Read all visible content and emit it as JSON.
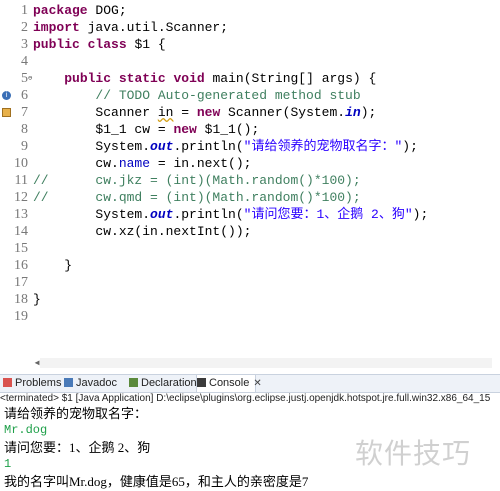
{
  "editor": {
    "lines": [
      {
        "n": "1",
        "segs": [
          {
            "t": "package",
            "c": "kw"
          },
          {
            "t": " DOG;",
            "c": ""
          }
        ]
      },
      {
        "n": "2",
        "segs": [
          {
            "t": "import",
            "c": "kw"
          },
          {
            "t": " java.util.Scanner;",
            "c": ""
          }
        ]
      },
      {
        "n": "3",
        "segs": [
          {
            "t": "public",
            "c": "kw"
          },
          {
            "t": " ",
            "c": ""
          },
          {
            "t": "class",
            "c": "kw"
          },
          {
            "t": " $1 {",
            "c": ""
          }
        ]
      },
      {
        "n": "4",
        "segs": []
      },
      {
        "n": "5",
        "segs": [
          {
            "t": "    ",
            "c": ""
          },
          {
            "t": "public",
            "c": "kw"
          },
          {
            "t": " ",
            "c": ""
          },
          {
            "t": "static",
            "c": "kw"
          },
          {
            "t": " ",
            "c": ""
          },
          {
            "t": "void",
            "c": "kw"
          },
          {
            "t": " main(String[] args) {",
            "c": ""
          }
        ]
      },
      {
        "n": "6",
        "segs": [
          {
            "t": "        // TODO Auto-generated method stub",
            "c": "cm"
          }
        ]
      },
      {
        "n": "7",
        "segs": [
          {
            "t": "        Scanner ",
            "c": ""
          },
          {
            "t": "in",
            "c": "sq"
          },
          {
            "t": " = ",
            "c": ""
          },
          {
            "t": "new",
            "c": "kw"
          },
          {
            "t": " Scanner(System.",
            "c": ""
          },
          {
            "t": "in",
            "c": "sfld"
          },
          {
            "t": ");",
            "c": ""
          }
        ]
      },
      {
        "n": "8",
        "segs": [
          {
            "t": "        $1_1 cw = ",
            "c": ""
          },
          {
            "t": "new",
            "c": "kw"
          },
          {
            "t": " $1_1();",
            "c": ""
          }
        ]
      },
      {
        "n": "9",
        "segs": [
          {
            "t": "        System.",
            "c": ""
          },
          {
            "t": "out",
            "c": "sfld"
          },
          {
            "t": ".println(",
            "c": ""
          },
          {
            "t": "\"请给领养的宠物取名字：\"",
            "c": "str"
          },
          {
            "t": ");",
            "c": ""
          }
        ]
      },
      {
        "n": "10",
        "segs": [
          {
            "t": "        cw.",
            "c": ""
          },
          {
            "t": "name",
            "c": "fld"
          },
          {
            "t": " = in.next();",
            "c": ""
          }
        ]
      },
      {
        "n": "11",
        "segs": [
          {
            "t": "//      cw.jkz = (int)(Math.random()*100);",
            "c": "cm"
          }
        ]
      },
      {
        "n": "12",
        "segs": [
          {
            "t": "//      cw.qmd = (int)(Math.random()*100);",
            "c": "cm"
          }
        ]
      },
      {
        "n": "13",
        "segs": [
          {
            "t": "        System.",
            "c": ""
          },
          {
            "t": "out",
            "c": "sfld"
          },
          {
            "t": ".println(",
            "c": ""
          },
          {
            "t": "\"请问您要：1、企鹅 2、狗\"",
            "c": "str"
          },
          {
            "t": ");",
            "c": ""
          }
        ]
      },
      {
        "n": "14",
        "segs": [
          {
            "t": "        cw.xz(in.nextInt());",
            "c": ""
          }
        ]
      },
      {
        "n": "15",
        "segs": []
      },
      {
        "n": "16",
        "segs": [
          {
            "t": "    }",
            "c": ""
          }
        ]
      },
      {
        "n": "17",
        "segs": []
      },
      {
        "n": "18",
        "segs": [
          {
            "t": "}",
            "c": ""
          }
        ]
      },
      {
        "n": "19",
        "segs": []
      }
    ]
  },
  "tabs": [
    {
      "label": "Problems",
      "icon": "problems-icon",
      "color": "#d9534f"
    },
    {
      "label": "Javadoc",
      "icon": "javadoc-icon",
      "color": "#4a7ab8"
    },
    {
      "label": "Declaration",
      "icon": "declaration-icon",
      "color": "#5b8a3c"
    },
    {
      "label": "Console",
      "icon": "console-icon",
      "color": "#3b3b3b",
      "active": true
    }
  ],
  "console": {
    "header": "<terminated> $1 [Java Application] D:\\eclipse\\plugins\\org.eclipse.justj.openjdk.hotspot.jre.full.win32.x86_64_15",
    "lines": [
      {
        "t": "请给领养的宠物取名字：",
        "input": false
      },
      {
        "t": "Mr.dog",
        "input": true
      },
      {
        "t": "请问您要：1、企鹅 2、狗",
        "input": false
      },
      {
        "t": "1",
        "input": true
      },
      {
        "t": "我的名字叫Mr.dog，健康值是65，和主人的亲密度是7",
        "input": false
      }
    ]
  },
  "watermark": "软件技巧",
  "colors": {
    "keyword": "#7f0055",
    "comment": "#3f7f5f",
    "string": "#2a00ff",
    "field": "#0000c0",
    "console_input": "#1fa04a"
  }
}
